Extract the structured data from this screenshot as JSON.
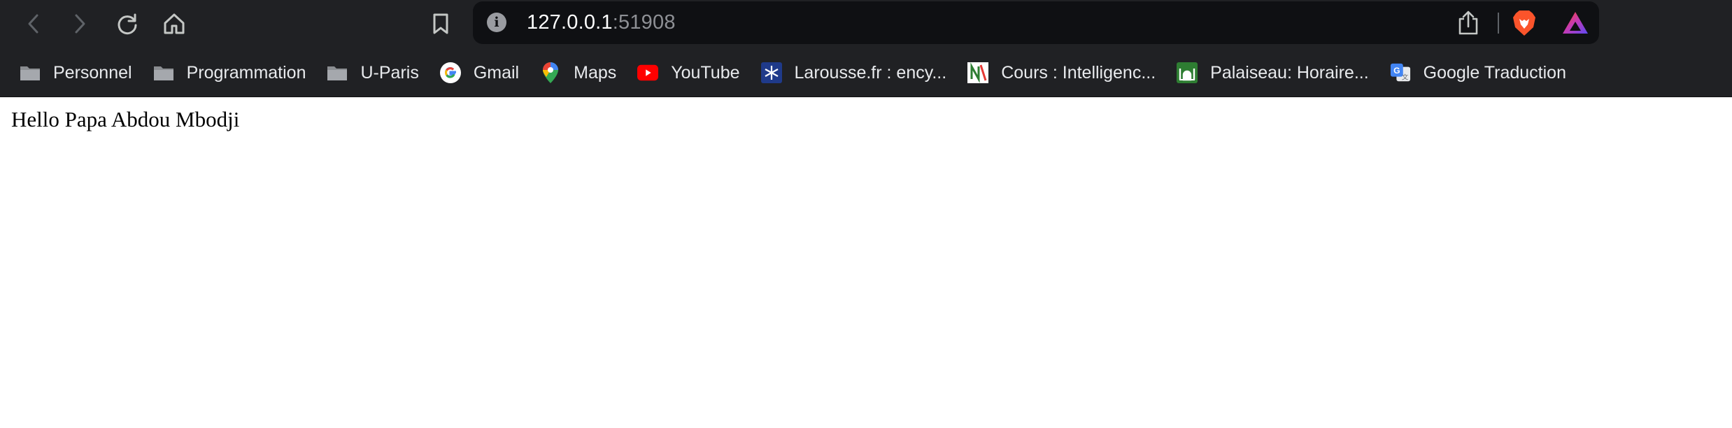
{
  "address_bar": {
    "host": "127.0.0.1",
    "port": ":51908"
  },
  "bookmarks": [
    {
      "label": "Personnel",
      "icon": "folder-icon"
    },
    {
      "label": "Programmation",
      "icon": "folder-icon"
    },
    {
      "label": "U-Paris",
      "icon": "folder-icon"
    },
    {
      "label": "Gmail",
      "icon": "google-icon"
    },
    {
      "label": "Maps",
      "icon": "maps-pin-icon"
    },
    {
      "label": "YouTube",
      "icon": "youtube-icon"
    },
    {
      "label": "Larousse.fr : ency...",
      "icon": "larousse-icon"
    },
    {
      "label": "Cours : Intelligenc...",
      "icon": "cours-icon"
    },
    {
      "label": "Palaiseau: Horaire...",
      "icon": "mosque-icon"
    },
    {
      "label": "Google Traduction",
      "icon": "google-translate-icon"
    }
  ],
  "page": {
    "greeting": "Hello Papa Abdou Mbodji"
  },
  "colors": {
    "chrome_bg": "#202124",
    "omnibox_bg": "#0f1013",
    "brave_orange": "#fb542b"
  }
}
